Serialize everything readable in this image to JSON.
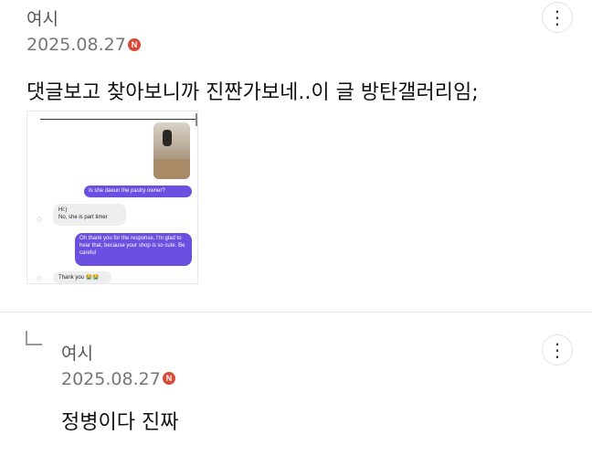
{
  "comment": {
    "author": "여시",
    "date": "2025.08.27",
    "new_badge": "N",
    "more_icon": "⋮",
    "text": "댓글보고 찾아보니까 진짠가보네..이 글 방탄갤러리임;",
    "attachment": {
      "messages": [
        {
          "dir": "out",
          "text": "Is she daeun the pastry owner?"
        },
        {
          "dir": "in",
          "text": "Hi:)\nNo, she is part timer"
        },
        {
          "dir": "out",
          "text": "Oh thank you for the response, I'm glad to hear that, because your shop is so cute. Be careful"
        },
        {
          "dir": "in",
          "text": "Thank you 😭😭"
        }
      ]
    }
  },
  "reply": {
    "author": "여시",
    "date": "2025.08.27",
    "new_badge": "N",
    "more_icon": "⋮",
    "text": "정병이다 진짜"
  },
  "colors": {
    "new_badge": "#d84a38",
    "bubble_out": "#6b4fe0",
    "bubble_in": "#eeeeee"
  }
}
